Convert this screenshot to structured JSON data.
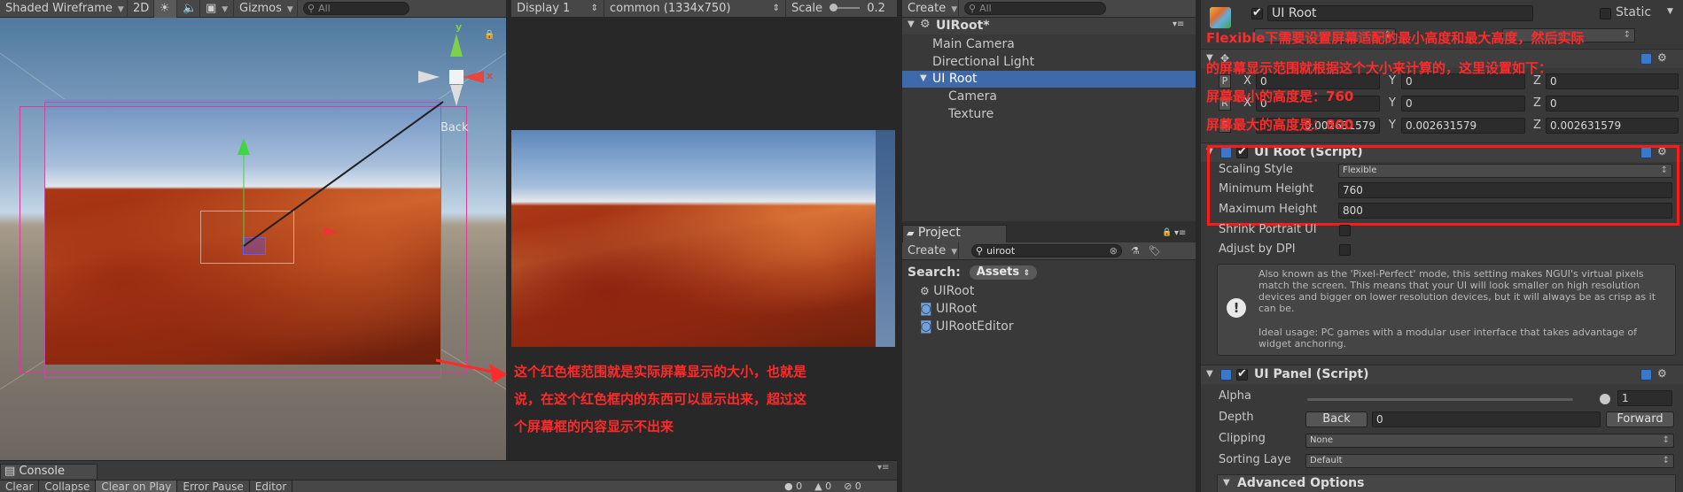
{
  "scene_toolbar": {
    "render_mode": "Shaded Wireframe",
    "mode_2d": "2D",
    "gizmos": "Gizmos",
    "search_placeholder": "All"
  },
  "scene_view": {
    "back_label": "Back",
    "annotation": "这个红色框范围就是实际屏幕显示的大小，也就是\n说，在这个红色框内的东西可以显示出来，超过这\n个屏幕框的内容显示不出来"
  },
  "game_toolbar": {
    "display": "Display 1",
    "resolution": "common (1334x750)",
    "scale_label": "Scale",
    "scale_value": "0.2"
  },
  "hierarchy": {
    "create_label": "Create",
    "search_placeholder": "All",
    "scene_name": "UIRoot*",
    "items": [
      {
        "label": "Main Camera",
        "selected": false,
        "indent": 1
      },
      {
        "label": "Directional Light",
        "selected": false,
        "indent": 1
      },
      {
        "label": "UI Root",
        "selected": true,
        "indent": 1
      },
      {
        "label": "Camera",
        "selected": false,
        "indent": 2
      },
      {
        "label": "Texture",
        "selected": false,
        "indent": 2
      }
    ]
  },
  "project": {
    "tab_label": "Project",
    "create_label": "Create",
    "search_value": "uiroot",
    "search_label": "Search:",
    "assets_tab": "Assets",
    "results": [
      {
        "label": "UIRoot",
        "icon": "unity-scene-icon"
      },
      {
        "label": "UIRoot",
        "icon": "csharp-script-icon"
      },
      {
        "label": "UIRootEditor",
        "icon": "csharp-script-icon"
      }
    ]
  },
  "console": {
    "tab_label": "Console",
    "buttons": [
      "Clear",
      "Collapse",
      "Clear on Play",
      "Error Pause",
      "Editor"
    ],
    "counts": [
      "0",
      "0",
      "0"
    ]
  },
  "inspector": {
    "object_name": "UI Root",
    "static_label": "Static",
    "annotation_lines": [
      "Flexible下需要设置屏幕适配的最小高度和最大高度，然后实际",
      "的屏幕显示范围就根据这个大小来计算的，这里设置如下：",
      "屏幕最小的高度是：760",
      "屏幕最大的高度是：800"
    ],
    "transform": {
      "position": {
        "x": "0",
        "y": "0",
        "z": "0"
      },
      "rotation": {
        "x": "0",
        "y": "0",
        "z": "0"
      },
      "scale": {
        "x": "0.002631579",
        "y": "0.002631579",
        "z": "0.002631579"
      }
    },
    "ui_root": {
      "title": "UI Root (Script)",
      "scaling_style_label": "Scaling Style",
      "scaling_style_value": "Flexible",
      "min_height_label": "Minimum Height",
      "min_height_value": "760",
      "max_height_label": "Maximum Height",
      "max_height_value": "800",
      "shrink_label": "Shrink Portrait UI",
      "adjust_dpi_label": "Adjust by DPI",
      "help_text": "Also known as the 'Pixel-Perfect' mode, this setting makes NGUI's virtual pixels match the screen. This means that your UI will look smaller on high resolution devices and bigger on lower resolution devices, but it will always be as crisp as it can be.",
      "help_text2": "Ideal usage: PC games with a modular user interface that takes advantage of widget anchoring."
    },
    "ui_panel": {
      "title": "UI Panel (Script)",
      "alpha_label": "Alpha",
      "alpha_value": "1",
      "depth_label": "Depth",
      "back_label": "Back",
      "depth_value": "0",
      "forward_label": "Forward",
      "clipping_label": "Clipping",
      "clipping_value": "None",
      "sorting_label": "Sorting Laye",
      "sorting_value": "Default",
      "advanced_label": "Advanced Options"
    }
  },
  "colors": {
    "selection": "#3e6aab",
    "annotation_red": "#ff2a2a",
    "pink_frame": "#e0389a"
  }
}
